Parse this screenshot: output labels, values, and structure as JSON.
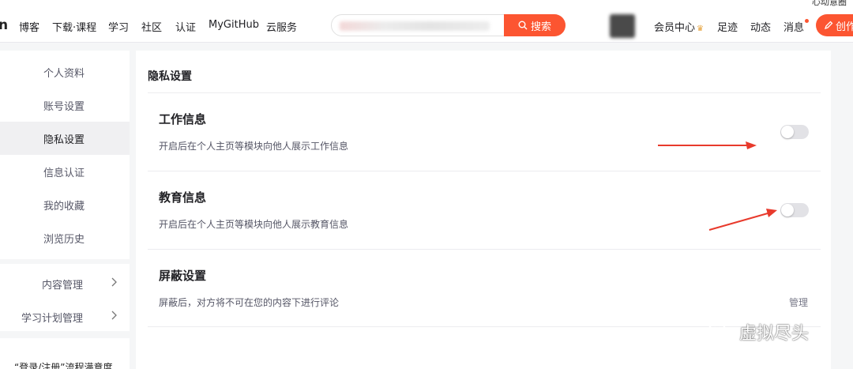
{
  "bookmarks": {
    "right": "心动意圈"
  },
  "nav": {
    "logo": "n",
    "items": [
      "博客",
      "下载·课程",
      "学习",
      "社区",
      "认证",
      "MyGitHub",
      "云服务"
    ],
    "search_label": "搜索",
    "vip_label": "会员中心",
    "right_items": [
      "足迹",
      "动态",
      "消息"
    ],
    "create_label": "创作",
    "accent": "#fc5531"
  },
  "sidebar": {
    "items": [
      "个人资料",
      "账号设置",
      "隐私设置",
      "信息认证",
      "我的收藏",
      "浏览历史"
    ],
    "active_index": 2,
    "sub_items": [
      "内容管理",
      "学习计划管理"
    ],
    "bottom_text": "“登录/注册”流程满意度"
  },
  "main": {
    "title": "隐私设置",
    "sections": [
      {
        "title": "工作信息",
        "desc": "开启后在个人主页等模块向他人展示工作信息",
        "toggle_on": false
      },
      {
        "title": "教育信息",
        "desc": "开启后在个人主页等模块向他人展示教育信息",
        "toggle_on": false
      },
      {
        "title": "屏蔽设置",
        "desc": "屏蔽后，对方将不可在您的内容下进行评论",
        "action": "管理"
      }
    ]
  },
  "watermark": "虚拟尽头"
}
